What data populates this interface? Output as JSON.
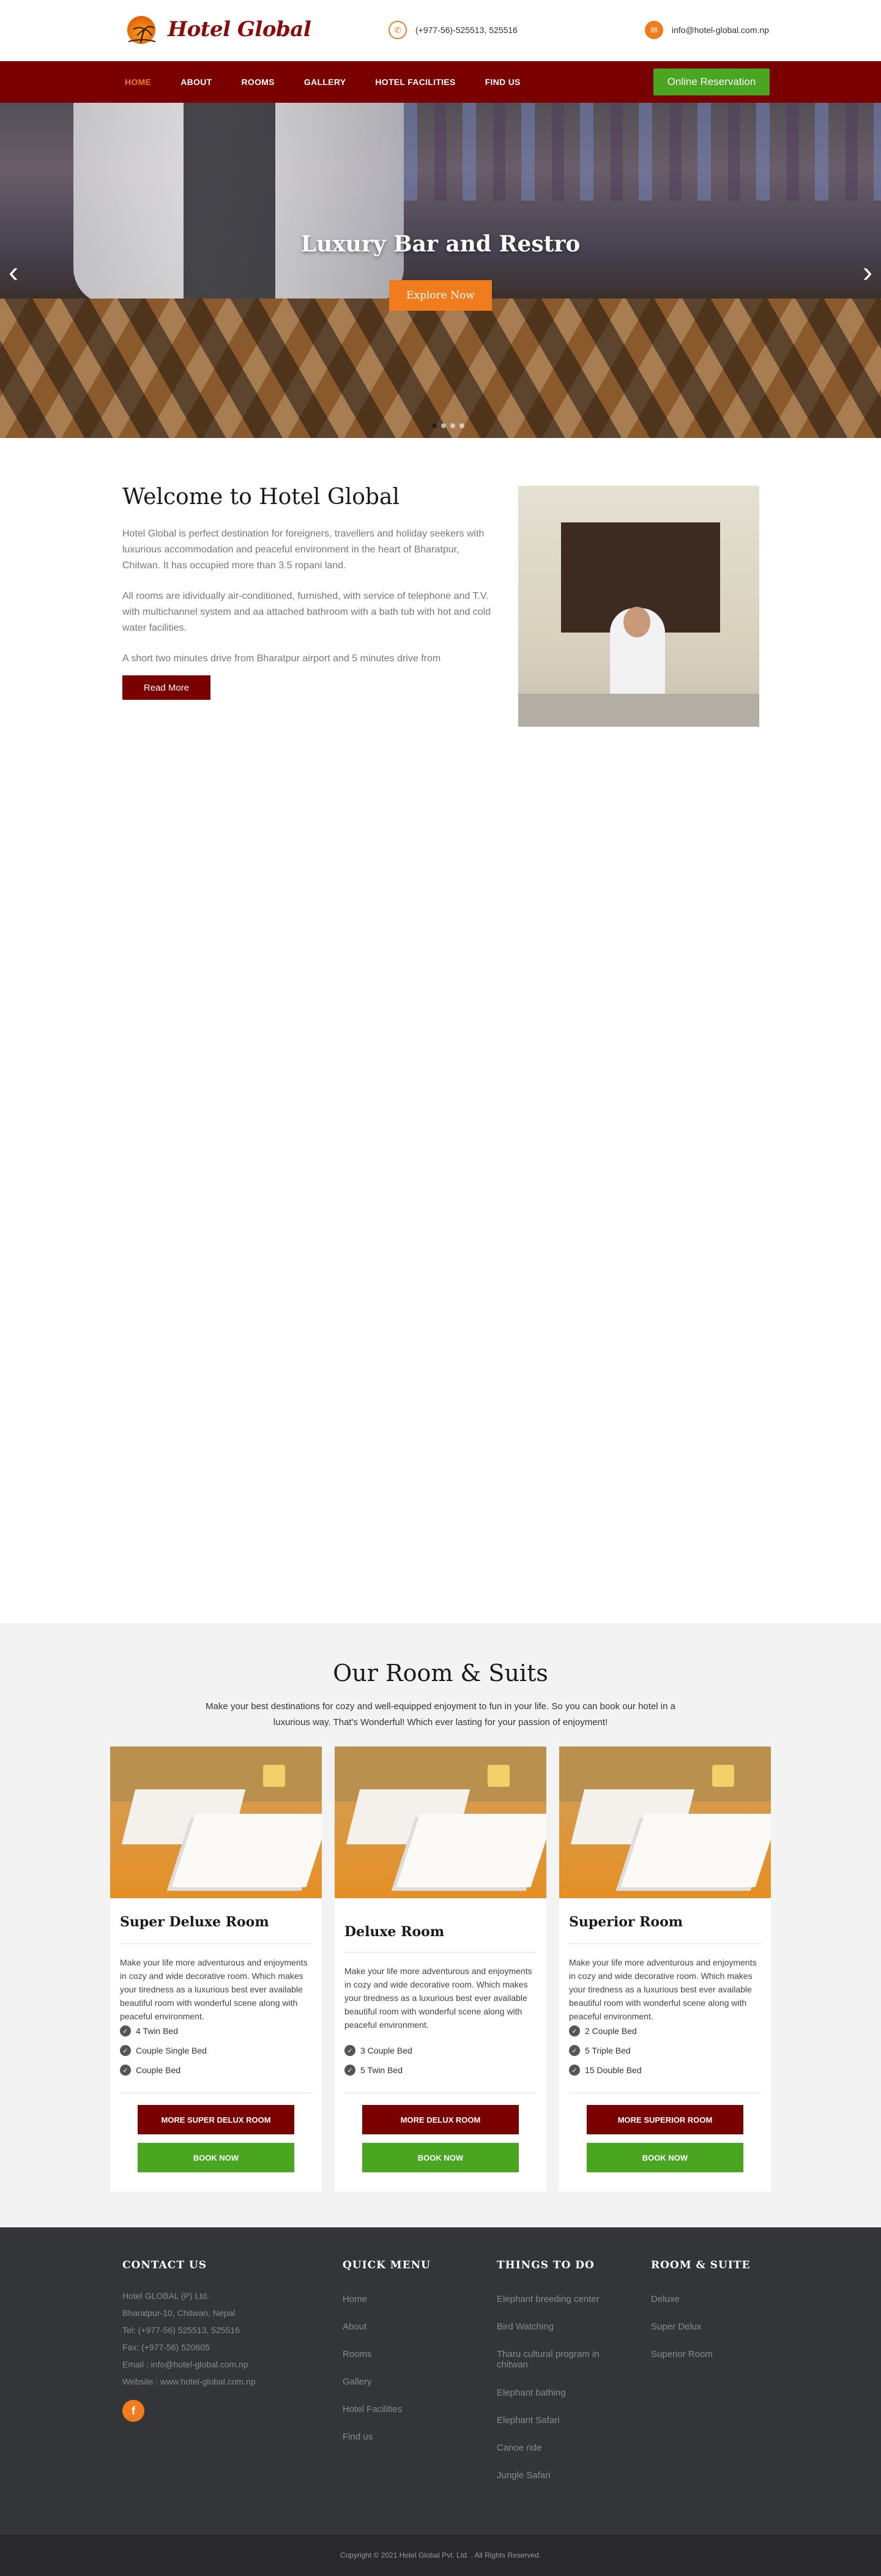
{
  "header": {
    "logo_text": "Hotel Global",
    "phone": "(+977-56)-525513, 525516",
    "email": "info@hotel-global.com.np"
  },
  "nav": {
    "items": [
      "HOME",
      "ABOUT",
      "ROOMS",
      "GALLERY",
      "HOTEL FACILITIES",
      "FIND US"
    ],
    "active_index": 0,
    "reserve_label": "Online Reservation"
  },
  "hero": {
    "title": "Luxury Bar and Restro",
    "button_label": "Explore Now",
    "slides_count": 4,
    "active_slide": 0
  },
  "welcome": {
    "title": "Welcome to Hotel Global",
    "paragraphs": [
      "Hotel Global is perfect destination for foreigners, travellers and holiday seekers with luxurious accommodation and peaceful environment in the heart of Bharatpur, Chitwan. It has occupied more than 3.5 ropani land.",
      "All rooms are idividually air-conditioned, furnished, with service of telephone and T.V. with multichannel system and aa attached bathroom with a bath tub with hot and cold water facilities.",
      "A short two minutes drive from Bharatpur airport and 5 minutes drive from"
    ],
    "button_label": "Read More"
  },
  "rooms": {
    "title": "Our Room & Suits",
    "subtitle": "Make your best destinations for cozy and well-equipped enjoyment to fun in your life. So you can book our hotel in a luxurious way. That's Wonderful! Which ever lasting for your passion of enjoyment!",
    "book_label": "BOOK NOW",
    "cards": [
      {
        "name": "Super Deluxe Room",
        "desc": "Make your life more adventurous and enjoyments in cozy and wide decorative room. Which makes your tiredness as a luxurious best ever available beautiful room with wonderful scene along with peaceful environment.",
        "features": [
          "4 Twin Bed",
          "Couple Single Bed",
          "Couple Bed"
        ],
        "more_label": "MORE SUPER DELUX ROOM"
      },
      {
        "name": "Deluxe Room",
        "desc": "Make your life more adventurous and enjoyments in cozy and wide decorative room. Which makes your tiredness as a luxurious best ever available beautiful room with wonderful scene along with peaceful environment.",
        "features": [
          "3 Couple Bed",
          "5 Twin Bed"
        ],
        "more_label": "MORE DELUX ROOM"
      },
      {
        "name": "Superior Room",
        "desc": "Make your life more adventurous and enjoyments in cozy and wide decorative room. Which makes your tiredness as a luxurious best ever available beautiful room with wonderful scene along with peaceful environment.",
        "features": [
          "2 Couple Bed",
          "5 Triple Bed",
          "15 Double Bed"
        ],
        "more_label": "MORE SUPERIOR ROOM"
      }
    ]
  },
  "footer": {
    "contact": {
      "title": "CONTACT US",
      "lines": [
        "Hotel GLOBAL (P) Ltd.",
        "Bharatpur-10, Chitwan, Nepal",
        "Tel: (+977-56) 525513, 525516",
        "Fax: (+977-56) 520605",
        "Email : info@hotel-global.com.np",
        "Website : www.hotel-global.com.np"
      ]
    },
    "quick_menu": {
      "title": "QUICK MENU",
      "items": [
        "Home",
        "About",
        "Rooms",
        "Gallery",
        "Hotel Facilities",
        "Find us"
      ]
    },
    "things": {
      "title": "THINGS TO DO",
      "items": [
        "Elephant breeding center",
        "Bird Watching",
        "Tharu cultural program in chitwan",
        "Elephant bathing",
        "Elephant Safari",
        "Canoe ride",
        "Jungle Safari"
      ]
    },
    "room_suite": {
      "title": "ROOM & SUITE",
      "items": [
        "Deluxe",
        "Super Delux",
        "Superior Room"
      ]
    },
    "copyright": "Copyright © 2021 Hotel Global Pvt. Ltd. . All Rights Reserved."
  },
  "colors": {
    "brand_red": "#7a0000",
    "accent_orange": "#f07c1e",
    "green": "#4aa521",
    "footer_bg": "#333538"
  }
}
